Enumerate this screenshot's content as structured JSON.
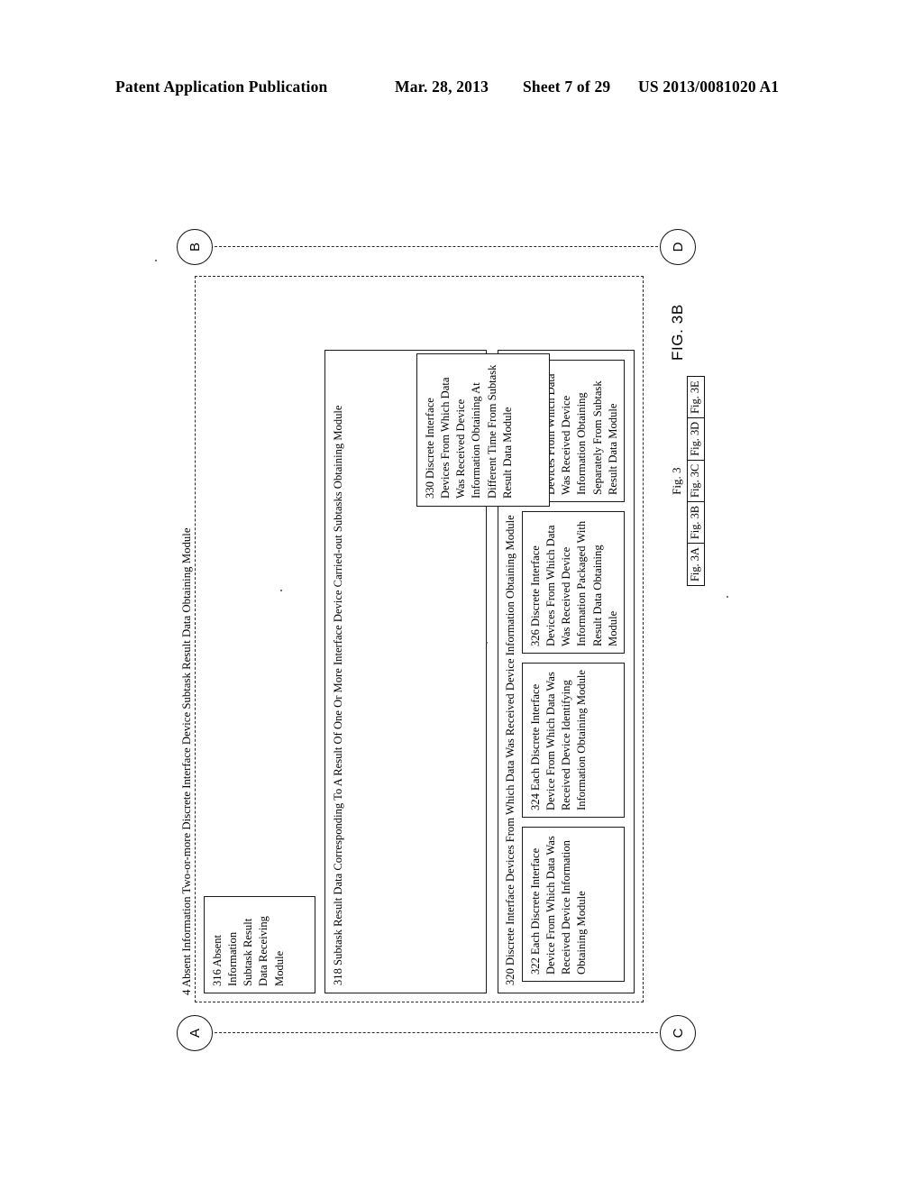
{
  "header": {
    "publication": "Patent Application Publication",
    "date": "Mar. 28, 2013",
    "sheet": "Sheet 7 of 29",
    "patent_number": "US 2013/0081020 A1"
  },
  "figure": {
    "caption": "FIG. 3B",
    "outer_module_label": "4 Absent Information Two-or-more Discrete Interface Device Subtask Result Data Obtaining Module",
    "connectors": [
      {
        "id": "A",
        "label": "A"
      },
      {
        "id": "B",
        "label": "B"
      },
      {
        "id": "C",
        "label": "C"
      },
      {
        "id": "D",
        "label": "D"
      }
    ],
    "blocks": {
      "b316": "316 Absent Information Subtask Result Data Receiving Module",
      "b318": "318 Subtask Result Data Corresponding To A Result Of One Or More Interface Device Carried-out Subtasks Obtaining Module",
      "b320": "320 Discrete Interface Devices From Which Data Was Received Device Information Obtaining Module",
      "b322": "322 Each Discrete Interface Device From Which Data Was Received Device Information Obtaining Module",
      "b324": "324 Each Discrete Interface Device From Which Data Was Received Device Identifying Information Obtaining Module",
      "b326": "326 Discrete Interface Devices From Which Data Was Received Device Information Packaged With Result Data Obtaining Module",
      "b328": "328 Discrete Interface Devices From Which Data Was Received Device Information Obtaining Separately From Subtask Result Data Module",
      "b330": "330 Discrete Interface Devices From Which Data Was Received Device Information Obtaining At Different Time From Subtask Result Data Module"
    },
    "index": {
      "title": "Fig. 3",
      "cells": [
        "Fig. 3A",
        "Fig. 3B",
        "Fig. 3C",
        "Fig. 3D",
        "Fig. 3E"
      ]
    }
  }
}
